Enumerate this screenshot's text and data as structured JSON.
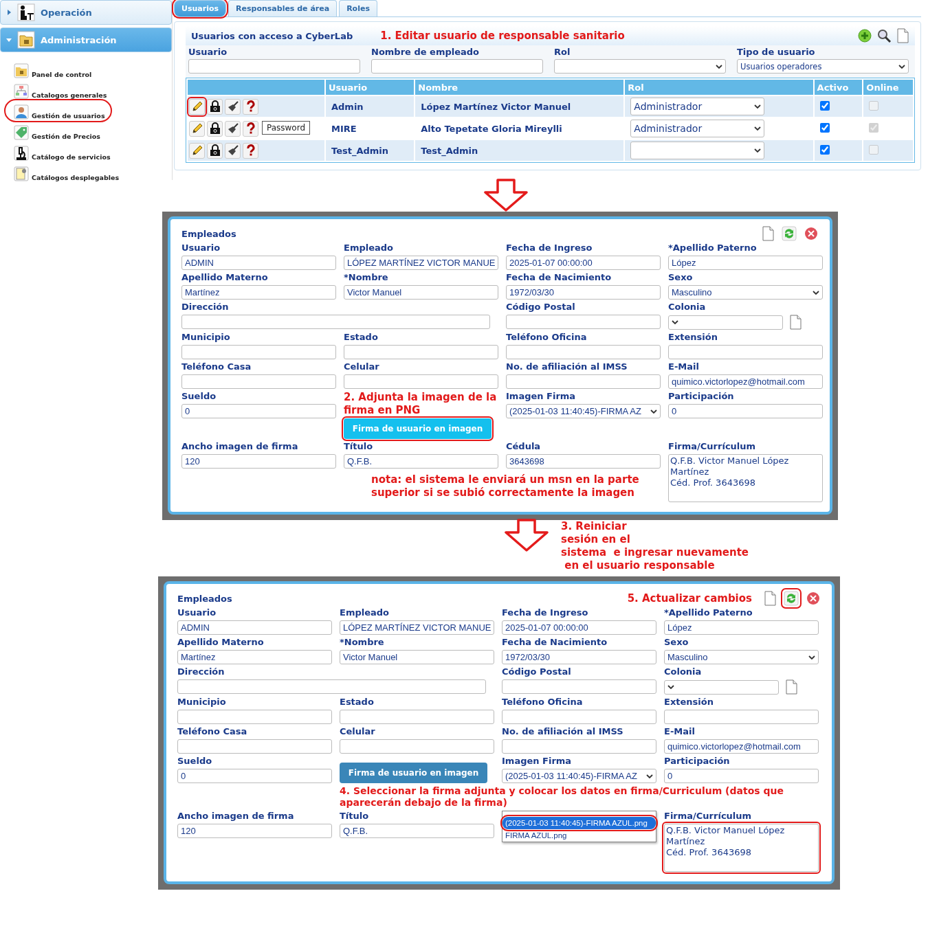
{
  "top": {
    "sidebar": [
      {
        "label": "Operación",
        "expanded": false
      },
      {
        "label": "Administración",
        "expanded": true,
        "items": [
          {
            "label": "Panel de control",
            "highlighted": false
          },
          {
            "label": "Catalogos generales",
            "highlighted": false
          },
          {
            "label": "Gestión de usuarios",
            "highlighted": true
          },
          {
            "label": "Gestión de Precios",
            "highlighted": false
          },
          {
            "label": "Catálogo de servicios",
            "highlighted": false
          },
          {
            "label": "Catálogos desplegables",
            "highlighted": false
          }
        ]
      }
    ],
    "tabs": [
      {
        "label": "Usuarios",
        "selected": true,
        "highlighted": true
      },
      {
        "label": "Responsables de área",
        "selected": false,
        "highlighted": false
      },
      {
        "label": "Roles",
        "selected": false,
        "highlighted": false
      }
    ],
    "title": "Usuarios con acceso a CyberLab",
    "annotation": "1. Editar usuario de responsable sanitario",
    "filters": [
      {
        "kind": "text",
        "label": "Usuario"
      },
      {
        "kind": "text",
        "label": "Nombre de empleado"
      },
      {
        "kind": "select",
        "label": "Rol"
      },
      {
        "kind": "select",
        "label": "Tipo de usuario",
        "value": "Usuarios operadores"
      }
    ],
    "columns": [
      "Usuario",
      "Nombre",
      "Rol",
      "Activo",
      "Online"
    ],
    "rows": [
      {
        "usuario": "Admin",
        "nombre": "López Martínez Victor Manuel",
        "rol": "Administrador",
        "activo": true,
        "online": false,
        "edit_highlighted": true
      },
      {
        "usuario": "MIRE",
        "nombre": "Alto Tepetate Gloria Mireylli",
        "rol": "Administrador",
        "activo": true,
        "online": true,
        "edit_highlighted": false,
        "tooltip": "Password"
      },
      {
        "usuario": "Test_Admin",
        "nombre": "Test_Admin",
        "activo": true,
        "online": false,
        "edit_highlighted": false
      }
    ]
  },
  "step3": [
    "3. Reiniciar",
    "sesión en el",
    "sistema  e ingresar nuevamente",
    " en el usuario responsable"
  ],
  "forms": [
    {
      "title": "Empleados",
      "refresh_highlighted": false,
      "cells": [
        {
          "kind": "text",
          "label": "Usuario",
          "value": "ADMIN"
        },
        {
          "kind": "text",
          "label": "Empleado",
          "value": "LÓPEZ MARTÍNEZ VICTOR MANUE"
        },
        {
          "kind": "text",
          "label": "Fecha de Ingreso",
          "value": "2025-01-07 00:00:00"
        },
        {
          "kind": "text",
          "label": "*Apellido Paterno",
          "value": "López"
        },
        {
          "kind": "text",
          "label": "Apellido Materno",
          "value": "Martínez"
        },
        {
          "kind": "text",
          "label": "*Nombre",
          "value": "Victor Manuel"
        },
        {
          "kind": "text",
          "label": "Fecha de Nacimiento",
          "value": "1972/03/30"
        },
        {
          "kind": "select",
          "label": "Sexo",
          "value": "Masculino"
        },
        {
          "kind": "wide",
          "label": "Dirección"
        },
        {
          "kind": "text",
          "label": "Código Postal"
        },
        {
          "kind": "select_doc",
          "label": "Colonia"
        },
        {
          "kind": "text",
          "label": "Municipio"
        },
        {
          "kind": "text",
          "label": "Estado"
        },
        {
          "kind": "text",
          "label": "Teléfono Oficina"
        },
        {
          "kind": "text",
          "label": "Extensión"
        },
        {
          "kind": "text",
          "label": "Teléfono Casa"
        },
        {
          "kind": "text",
          "label": "Celular"
        },
        {
          "kind": "text",
          "label": "No. de afiliación al IMSS"
        },
        {
          "kind": "text",
          "label": "E-Mail",
          "value": "quimico.victorlopez@hotmail.com"
        },
        {
          "kind": "text",
          "label": "Sueldo",
          "value": "0"
        },
        {
          "kind": "button",
          "text": "Firma de usuario en imagen",
          "highlighted": true,
          "note": "2. Adjunta la imagen de la firma en PNG"
        },
        {
          "kind": "select",
          "label": "Imagen Firma",
          "value": "(2025-01-03 11:40:45)-FIRMA AZ"
        },
        {
          "kind": "text",
          "label": "Participación",
          "value": "0"
        },
        {
          "kind": "text",
          "label": "Ancho imagen de firma",
          "value": "120"
        },
        {
          "kind": "text",
          "label": "Título",
          "value": "Q.F.B."
        },
        {
          "kind": "text",
          "label": "Cédula",
          "value": "3643698"
        },
        {
          "kind": "textarea",
          "label": "Firma/Currículum",
          "value": "Q.F.B. Victor Manuel López\nMartínez\nCéd. Prof. 3643698",
          "highlighted": false
        },
        {
          "kind": "note",
          "text": "nota: el sistema le enviará un msn en la parte superior si se subió correctamente la imagen"
        }
      ]
    },
    {
      "title": "Empleados",
      "refresh_highlighted": true,
      "annotation": "5. Actualizar cambios",
      "cells": [
        {
          "kind": "text",
          "label": "Usuario",
          "value": "ADMIN"
        },
        {
          "kind": "text",
          "label": "Empleado",
          "value": "LÓPEZ MARTÍNEZ VICTOR MANUE"
        },
        {
          "kind": "text",
          "label": "Fecha de Ingreso",
          "value": "2025-01-07 00:00:00"
        },
        {
          "kind": "text",
          "label": "*Apellido Paterno",
          "value": "López"
        },
        {
          "kind": "text",
          "label": "Apellido Materno",
          "value": "Martínez"
        },
        {
          "kind": "text",
          "label": "*Nombre",
          "value": "Victor Manuel"
        },
        {
          "kind": "text",
          "label": "Fecha de Nacimiento",
          "value": "1972/03/30"
        },
        {
          "kind": "select",
          "label": "Sexo",
          "value": "Masculino"
        },
        {
          "kind": "wide",
          "label": "Dirección"
        },
        {
          "kind": "text",
          "label": "Código Postal"
        },
        {
          "kind": "select_doc",
          "label": "Colonia"
        },
        {
          "kind": "text",
          "label": "Municipio"
        },
        {
          "kind": "text",
          "label": "Estado"
        },
        {
          "kind": "text",
          "label": "Teléfono Oficina"
        },
        {
          "kind": "text",
          "label": "Extensión"
        },
        {
          "kind": "text",
          "label": "Teléfono Casa"
        },
        {
          "kind": "text",
          "label": "Celular"
        },
        {
          "kind": "text",
          "label": "No. de afiliación al IMSS"
        },
        {
          "kind": "text",
          "label": "E-Mail",
          "value": "quimico.victorlopez@hotmail.com"
        },
        {
          "kind": "text",
          "label": "Sueldo",
          "value": "0"
        },
        {
          "kind": "button",
          "text": "Firma de usuario en imagen",
          "highlighted": false
        },
        {
          "kind": "select",
          "label": "Imagen Firma",
          "value": "(2025-01-03 11:40:45)-FIRMA AZ"
        },
        {
          "kind": "text",
          "label": "Participación",
          "value": "0"
        },
        {
          "kind": "callout",
          "text": "4. Seleccionar la firma adjunta y colocar los datos en firma/Curriculum (datos que aparecerán debajo de la firma)"
        },
        {
          "kind": "text",
          "label": "Ancho imagen de firma",
          "value": "120"
        },
        {
          "kind": "text",
          "label": "Título",
          "value": "Q.F.B."
        },
        {
          "kind": "listbox",
          "options": [
            {
              "label": "(2025-01-03 11:40:45)-FIRMA AZUL.png",
              "selected": true,
              "highlighted": true
            },
            {
              "label": "FIRMA AZUL.png",
              "selected": false,
              "highlighted": false
            }
          ]
        },
        {
          "kind": "textarea",
          "label": "Firma/Currículum",
          "value": "Q.F.B. Victor Manuel López\nMartínez\nCéd. Prof. 3643698",
          "highlighted": true
        }
      ]
    }
  ]
}
